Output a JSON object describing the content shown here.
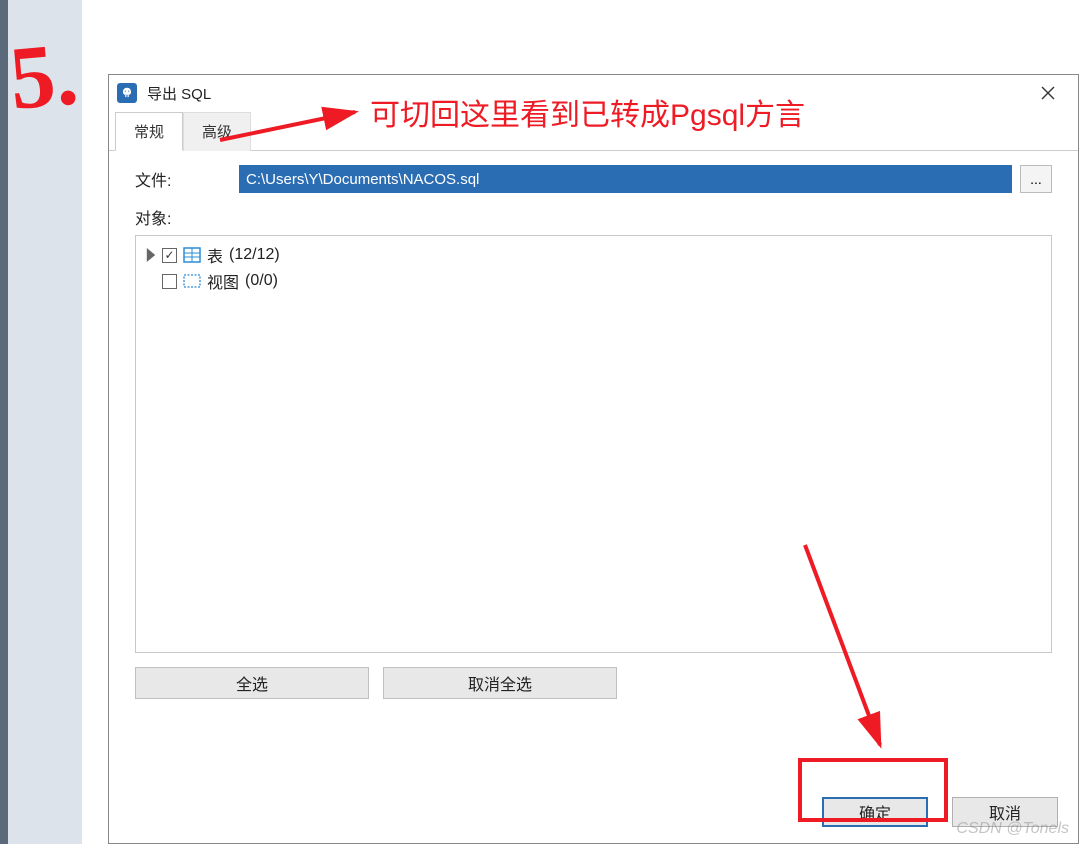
{
  "annotations": {
    "step_number": "5.",
    "note_text": "可切回这里看到已转成Pgsql方言"
  },
  "dialog": {
    "title": "导出 SQL",
    "tabs": {
      "general": "常规",
      "advanced": "高级"
    },
    "fields": {
      "file_label": "文件:",
      "file_value": "C:\\Users\\Y\\Documents\\NACOS.sql",
      "browse_label": "...",
      "objects_label": "对象:"
    },
    "tree": {
      "tables": {
        "label": "表",
        "count": "(12/12)",
        "checked": true
      },
      "views": {
        "label": "视图",
        "count": "(0/0)",
        "checked": false
      }
    },
    "buttons": {
      "select_all": "全选",
      "deselect_all": "取消全选",
      "ok": "确定",
      "cancel": "取消"
    }
  },
  "watermark": "CSDN @Tonels"
}
